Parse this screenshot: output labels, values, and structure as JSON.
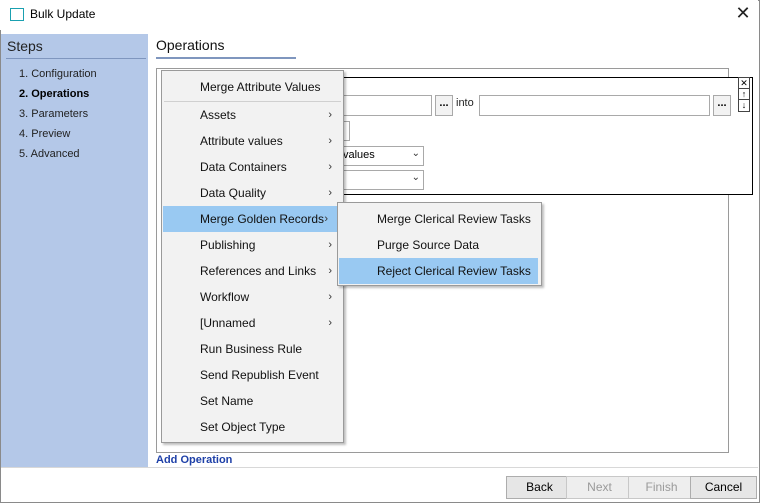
{
  "window": {
    "title": "Bulk Update",
    "close_glyph": "✕"
  },
  "sidebar": {
    "title": "Steps",
    "steps": [
      {
        "label": "1. Configuration"
      },
      {
        "label": "2. Operations"
      },
      {
        "label": "3. Parameters"
      },
      {
        "label": "4. Preview"
      },
      {
        "label": "5. Advanced"
      }
    ]
  },
  "main": {
    "title": "Operations",
    "op": {
      "into_label": "into",
      "browse_label": "...",
      "select1_value": "values",
      "select2_value": ""
    },
    "add_operation": "Add Operation"
  },
  "context_menu": {
    "items": [
      {
        "label": "Merge Attribute Values",
        "submenu": false
      },
      {
        "label": "Assets",
        "submenu": true
      },
      {
        "label": "Attribute values",
        "submenu": true
      },
      {
        "label": "Data Containers",
        "submenu": true
      },
      {
        "label": "Data Quality",
        "submenu": true
      },
      {
        "label": "Merge Golden Records",
        "submenu": true
      },
      {
        "label": "Publishing",
        "submenu": true
      },
      {
        "label": "References and Links",
        "submenu": true
      },
      {
        "label": "Workflow",
        "submenu": true
      },
      {
        "label": "[Unnamed",
        "submenu": true
      },
      {
        "label": "Run Business Rule",
        "submenu": false
      },
      {
        "label": "Send Republish Event",
        "submenu": false
      },
      {
        "label": "Set Name",
        "submenu": false
      },
      {
        "label": "Set Object Type",
        "submenu": false
      }
    ],
    "highlighted": "Merge Golden Records",
    "arrow_glyph": "›"
  },
  "submenu": {
    "items": [
      {
        "label": "Merge Clerical Review Tasks"
      },
      {
        "label": "Purge Source Data"
      },
      {
        "label": "Reject Clerical Review Tasks"
      }
    ],
    "highlighted": "Reject Clerical Review Tasks"
  },
  "footer": {
    "back_label": "Back",
    "next_label": "Next",
    "finish_label": "Finish",
    "cancel_label": "Cancel"
  },
  "colors": {
    "sidebar_bg": "#b4c8e8",
    "highlight": "#99c9f2",
    "link": "#1e40a8"
  }
}
